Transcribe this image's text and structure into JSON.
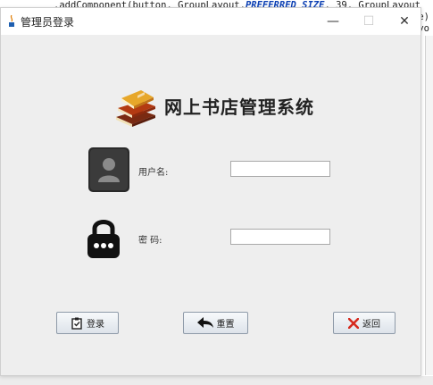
{
  "editor": {
    "code_prefix": ".addComponent(button, GroupLayout.",
    "code_keyword": "PREFERRED_SIZE",
    "code_suffix": ", 39, GroupLayout",
    "right_frag_1": "e)",
    "right_frag_2": "yo"
  },
  "window": {
    "title": "管理员登录",
    "minimize_glyph": "—",
    "maximize_glyph": "☐",
    "close_glyph": "✕"
  },
  "heading": "网上书店管理系统",
  "form": {
    "username_label": "用户名:",
    "username_value": "",
    "password_label": "密  码:",
    "password_value": ""
  },
  "buttons": {
    "login": "登录",
    "reset": "重置",
    "back": "返回"
  },
  "icons": {
    "app": "coffee-cup-icon",
    "logo": "books-icon",
    "user": "user-silhouette-icon",
    "lock": "padlock-icon",
    "login": "clipboard-check-icon",
    "reset": "back-arrow-icon",
    "back": "red-x-icon"
  },
  "colors": {
    "window_bg": "#eeeeee",
    "titlebar_bg": "#ffffff",
    "back_icon": "#d62a1f"
  }
}
